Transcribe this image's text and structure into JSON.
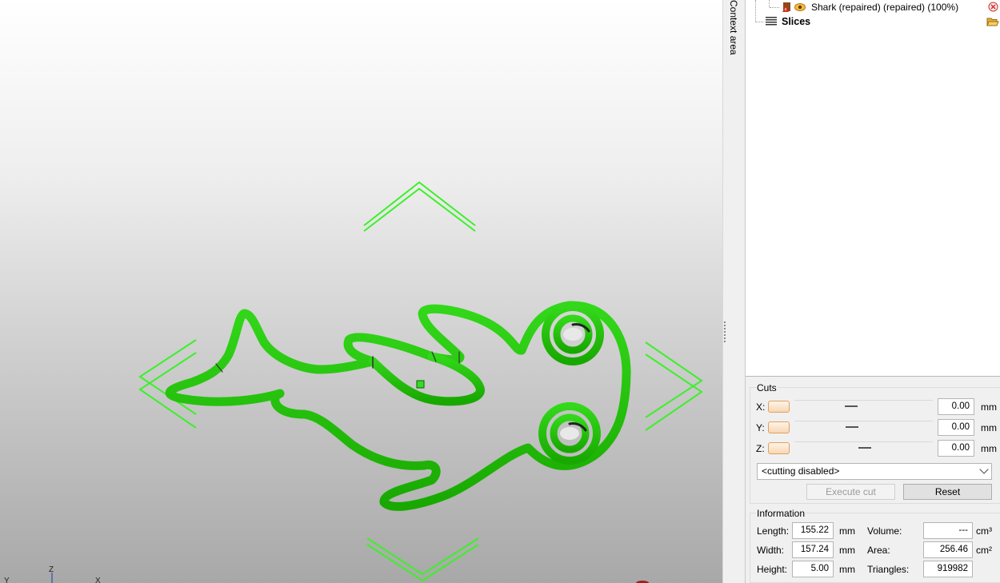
{
  "viewport": {
    "axes": {
      "z": "Z",
      "y": "Y",
      "x": "X"
    }
  },
  "context_area": {
    "label": "Context area"
  },
  "tree": {
    "part": {
      "name": "Shark (repaired) (repaired) (100%)"
    },
    "slices": {
      "name": "Slices"
    }
  },
  "cuts": {
    "title": "Cuts",
    "x": {
      "label": "X:",
      "value": "0.00",
      "unit": "mm"
    },
    "y": {
      "label": "Y:",
      "value": "0.00",
      "unit": "mm"
    },
    "z": {
      "label": "Z:",
      "value": "0.00",
      "unit": "mm"
    },
    "mode": "<cutting disabled>",
    "execute_label": "Execute cut",
    "reset_label": "Reset"
  },
  "information": {
    "title": "Information",
    "length": {
      "label": "Length:",
      "value": "155.22",
      "unit": "mm"
    },
    "width": {
      "label": "Width:",
      "value": "157.24",
      "unit": "mm"
    },
    "height": {
      "label": "Height:",
      "value": "5.00",
      "unit": "mm"
    },
    "volume": {
      "label": "Volume:",
      "value": "---",
      "unit": "cm³"
    },
    "area": {
      "label": "Area:",
      "value": "256.46",
      "unit": "cm²"
    },
    "triangles": {
      "label": "Triangles:",
      "value": "919982"
    }
  },
  "colors": {
    "model": "#22cc00",
    "gizmo": "#33ee22",
    "accent": "#e0a060"
  }
}
